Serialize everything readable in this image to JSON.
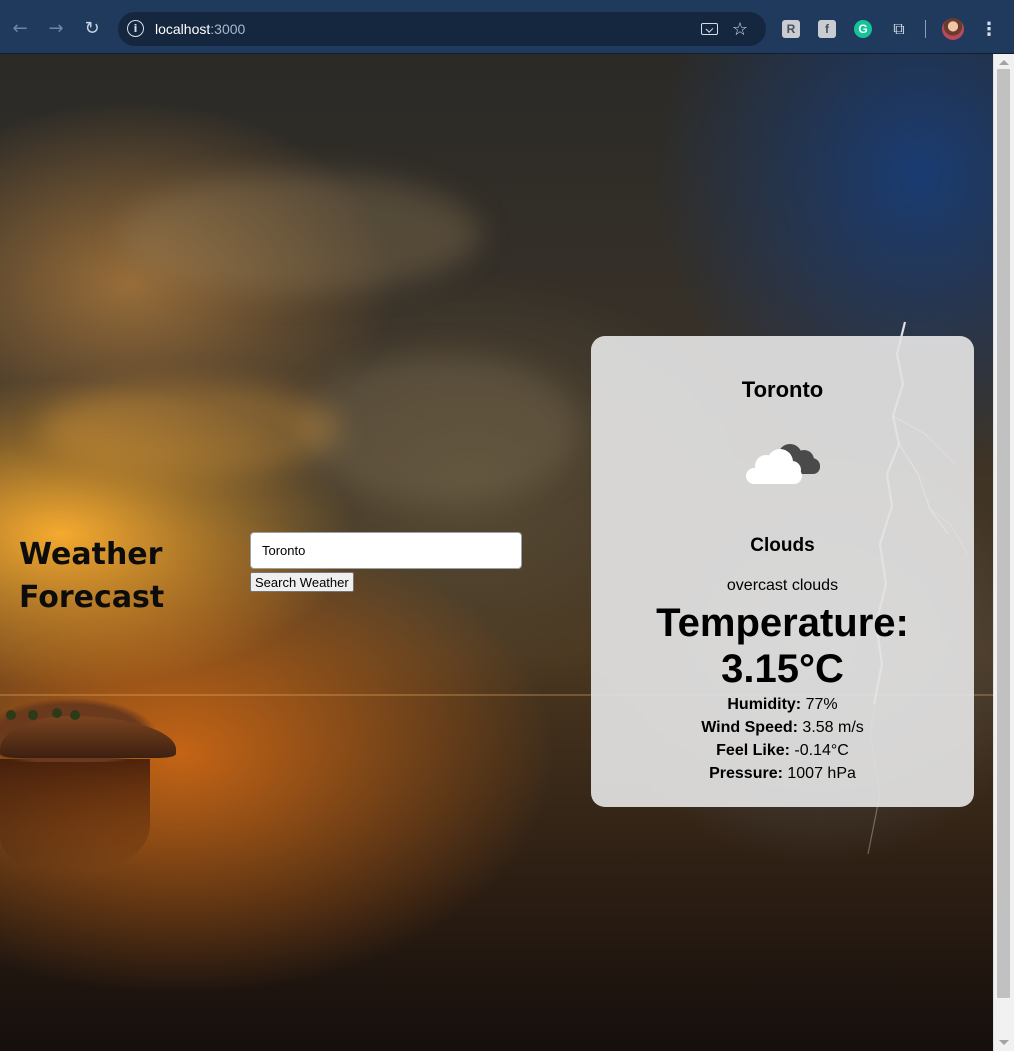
{
  "browser": {
    "url_host": "localhost",
    "url_port": ":3000",
    "icons": {
      "back": "arrow-left-icon",
      "forward": "arrow-right-icon",
      "reload": "reload-icon",
      "site_info": "info-icon",
      "install": "install-app-icon",
      "bookmark": "star-icon",
      "menu": "kebab-icon"
    },
    "extensions": [
      {
        "name": "ext-r",
        "glyph": "R"
      },
      {
        "name": "ext-f",
        "glyph": "f"
      },
      {
        "name": "ext-grammarly",
        "glyph": "G"
      }
    ]
  },
  "page": {
    "title_line1": "Weather",
    "title_line2": "Forecast",
    "search_value": "Toronto",
    "search_button": "Search Weather"
  },
  "weather": {
    "city": "Toronto",
    "icon": "overcast-clouds-icon",
    "main": "Clouds",
    "description": "overcast clouds",
    "temperature_label": "Temperature:",
    "temperature_value": "3.15°C",
    "humidity_label": "Humidity:",
    "humidity_value": "77%",
    "wind_label": "Wind Speed:",
    "wind_value": "3.58 m/s",
    "feel_label": "Feel Like:",
    "feel_value": "-0.14°C",
    "pressure_label": "Pressure:",
    "pressure_value": "1007 hPa"
  },
  "colors": {
    "chrome_bg": "#1f3a5c",
    "card_bg": "#e2e2e2",
    "text": "#000000"
  }
}
